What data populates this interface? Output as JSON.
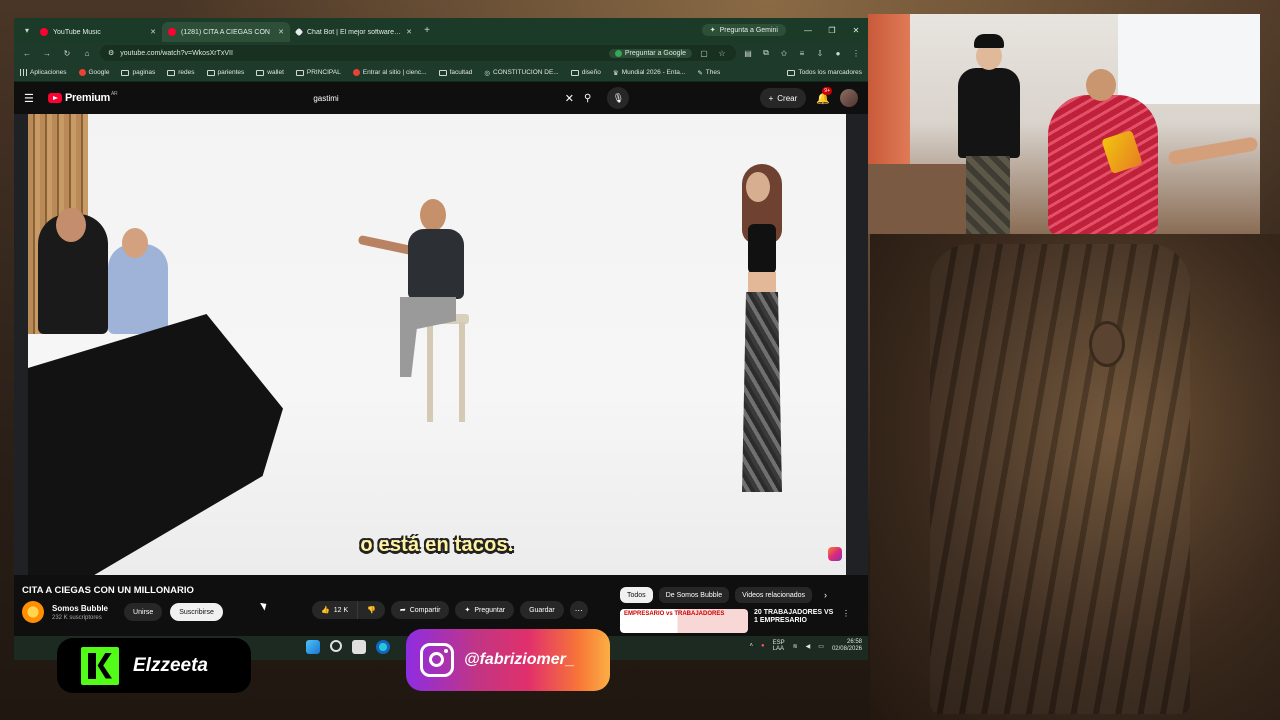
{
  "browser": {
    "tabs": [
      {
        "label": "YouTube Music",
        "active": false
      },
      {
        "label": "(1281) CITA A CIEGAS CON",
        "active": true
      },
      {
        "label": "Chat Bot | El mejor software pa",
        "active": false
      }
    ],
    "gemini_label": "Pregunta a Gemini",
    "url": "youtube.com/watch?v=WkosXrTxVII",
    "ask_google_label": "Preguntar a Google",
    "bookmarks": [
      "Aplicaciones",
      "Google",
      "paginas",
      "redes",
      "parientes",
      "wallet",
      "PRINCIPAL",
      "Entrar al sitio | cienc...",
      "facultad",
      "CONSTITUCION DE...",
      "diseño",
      "Mundial 2026 - Enta...",
      "Thes"
    ],
    "all_bookmarks_label": "Todos los marcadores"
  },
  "youtube": {
    "logo_text": "Premium",
    "logo_region": "AR",
    "search_query": "gastimi",
    "create_label": "Crear",
    "notifications_badge": "9+",
    "subtitle": "o está en tacos.",
    "video_title": "CITA A CIEGAS CON UN MILLONARIO",
    "channel_name": "Somos Bubble",
    "channel_subs": "232 K suscriptores",
    "join_label": "Unirse",
    "subscribe_label": "Suscribirse",
    "likes": "12 K",
    "share_label": "Compartir",
    "ask_label": "Preguntar",
    "save_label": "Guardar",
    "chips": [
      "Todos",
      "De Somos Bubble",
      "Videos relacionados"
    ],
    "recommendation": {
      "thumb_text": "EMPRESARIO vs TRABAJADORES",
      "title": "20 TRABAJADORES VS 1 EMPRESARIO"
    }
  },
  "taskbar": {
    "lang_top": "ESP",
    "lang_bottom": "LAA",
    "time": "26:58",
    "date": "02/08/2026"
  },
  "overlays": {
    "kick_name": "Elzzeeta",
    "instagram_handle": "@fabriziomer_"
  },
  "colors": {
    "kick_green": "#53fc18",
    "youtube_red": "#ff0033",
    "subtitle_yellow": "#fff3a0"
  }
}
